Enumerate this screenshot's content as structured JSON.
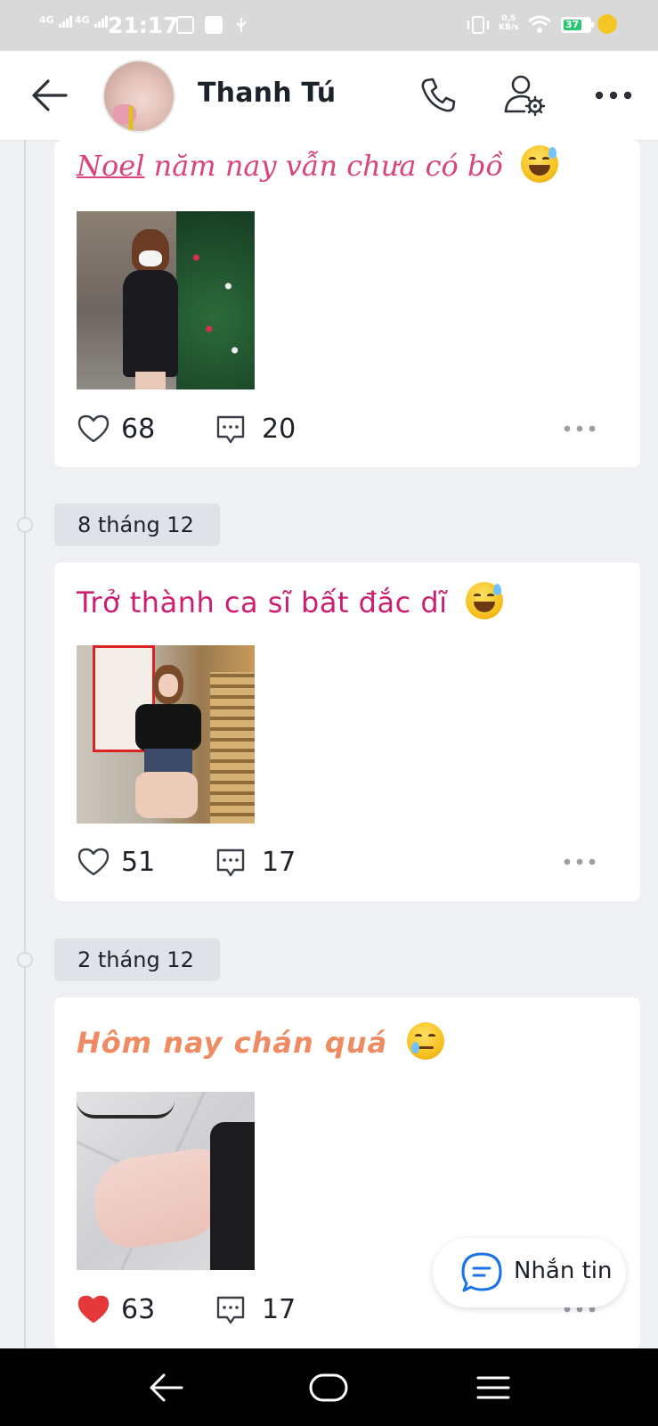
{
  "status_bar": {
    "network_1": "4G",
    "network_2": "4G",
    "time": "21:17",
    "net_speed_value": "0,5",
    "net_speed_unit": "KB/s",
    "battery_level": "37"
  },
  "header": {
    "contact_name": "Thanh Tú",
    "icons": [
      "back-arrow-icon",
      "phone-icon",
      "user-settings-icon",
      "more-icon"
    ]
  },
  "posts": [
    {
      "text_link": "Noel",
      "text": " năm nay vẫn chưa có bồ",
      "emoji": "grinning-sweat",
      "likes": "68",
      "liked": false,
      "comments": "20"
    },
    {
      "date": "8 tháng 12",
      "text": "Trở thành ca sĩ bất đắc dĩ",
      "emoji": "grinning-sweat",
      "likes": "51",
      "liked": false,
      "comments": "17"
    },
    {
      "date": "2 tháng 12",
      "text": "Hôm nay chán quá",
      "emoji": "smiling-tear",
      "likes": "63",
      "liked": true,
      "comments": "17"
    }
  ],
  "message_button": {
    "label": "Nhắn tin"
  },
  "colors": {
    "like_active": "#e5383b",
    "accent": "#1a73e8",
    "post1_text": "#d9447e",
    "post2_text": "#cc1f71",
    "post3_text": "#ef8b62"
  }
}
